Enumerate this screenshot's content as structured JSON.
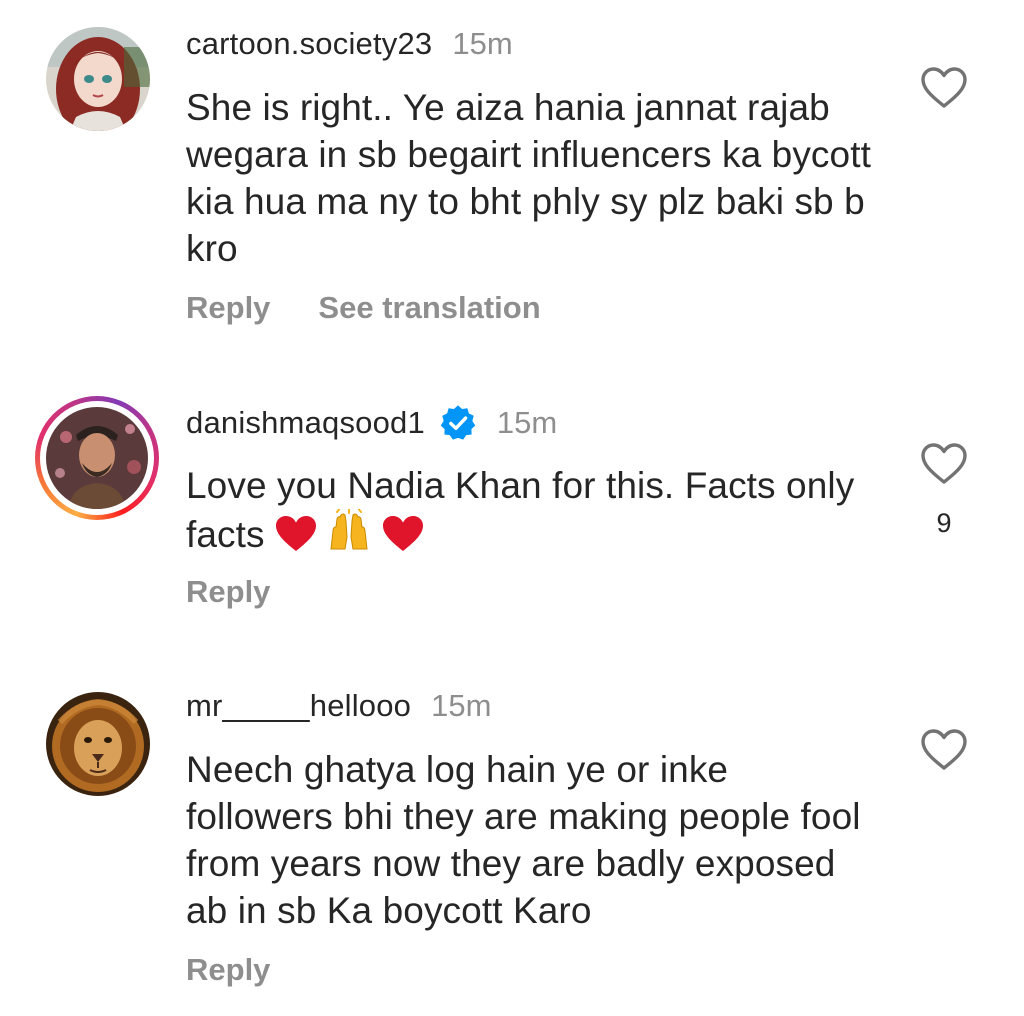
{
  "comments": [
    {
      "username": "cartoon.society23",
      "time": "15m",
      "text": "She is right.. Ye aiza hania jannat rajab wegara in sb begairt influencers ka bycott kia hua ma ny to bht phly sy plz baki sb b kro",
      "reply_label": "Reply",
      "translation_label": "See translation",
      "avatar_icon": "cartoon-girl-avatar",
      "like_icon": "heart-outline-icon"
    },
    {
      "username": "danishmaqsood1",
      "verified": true,
      "verified_icon": "blue-check-icon",
      "time": "15m",
      "text": "Love you Nadia Khan for this. Facts only facts",
      "emojis": [
        "red-heart",
        "raising-hands",
        "red-heart"
      ],
      "reply_label": "Reply",
      "likes": "9",
      "avatar_icon": "man-portrait-avatar",
      "has_story_ring": true,
      "like_icon": "heart-outline-icon"
    },
    {
      "username": "mr_____hellooo",
      "time": "15m",
      "text": "Neech ghatya log hain ye or inke followers bhi they are making people fool from years now they are badly exposed ab in sb Ka boycott Karo",
      "reply_label": "Reply",
      "avatar_icon": "lion-avatar",
      "like_icon": "heart-outline-icon"
    }
  ],
  "colors": {
    "text": "#262626",
    "secondary": "#8e8e8e",
    "verified_blue": "#0095f6",
    "heart_red": "#e0142b"
  }
}
